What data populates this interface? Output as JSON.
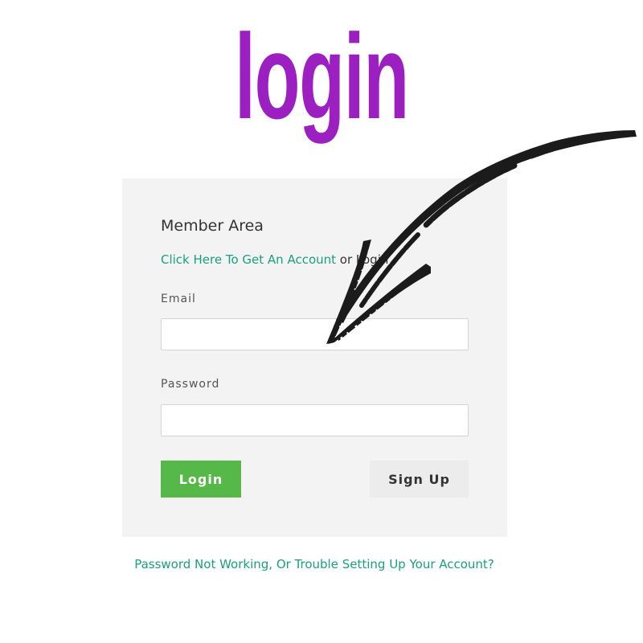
{
  "header": {
    "title": "login"
  },
  "panel": {
    "heading": "Member Area",
    "signup_link": "Click Here To Get An Account",
    "signup_suffix": " or Login",
    "email_label": "Email",
    "email_value": "",
    "password_label": "Password",
    "password_value": "",
    "login_button": "Login",
    "signup_button": "Sign Up"
  },
  "footer": {
    "trouble_link": "Password Not Working, Or Trouble Setting Up Your Account?"
  },
  "colors": {
    "title": "#9b1fc1",
    "link": "#1aa07d",
    "login_button": "#55b848",
    "panel_background": "#f3f3f3"
  },
  "icons": {
    "arrow": "hand-drawn-arrow-icon"
  }
}
